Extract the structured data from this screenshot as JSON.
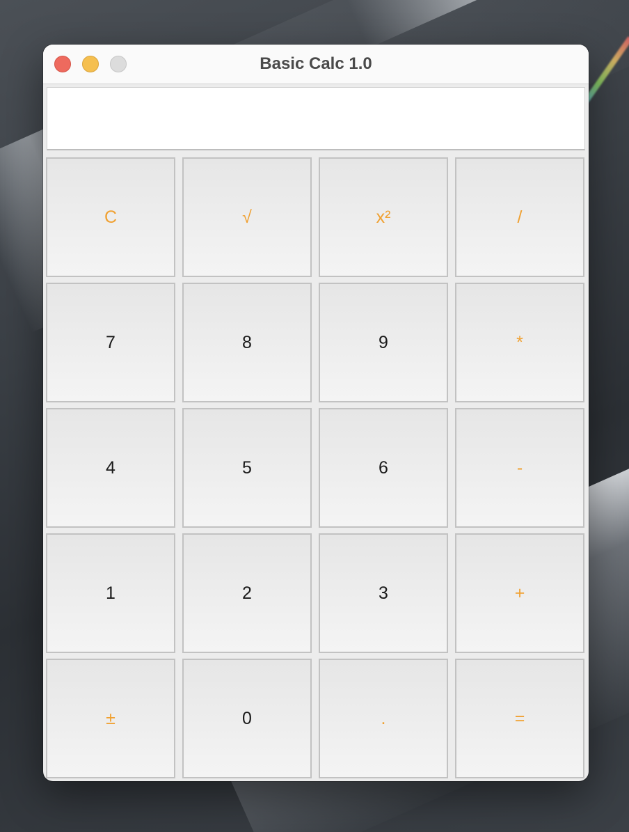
{
  "window": {
    "title": "Basic Calc 1.0"
  },
  "display": {
    "value": ""
  },
  "keys": [
    [
      {
        "label": "C",
        "kind": "op",
        "name": "clear-button"
      },
      {
        "label": "√",
        "kind": "op",
        "name": "sqrt-button"
      },
      {
        "label": "x²",
        "kind": "op",
        "name": "square-button"
      },
      {
        "label": "/",
        "kind": "op",
        "name": "divide-button"
      }
    ],
    [
      {
        "label": "7",
        "kind": "digit",
        "name": "digit-7-button"
      },
      {
        "label": "8",
        "kind": "digit",
        "name": "digit-8-button"
      },
      {
        "label": "9",
        "kind": "digit",
        "name": "digit-9-button"
      },
      {
        "label": "*",
        "kind": "op",
        "name": "multiply-button"
      }
    ],
    [
      {
        "label": "4",
        "kind": "digit",
        "name": "digit-4-button"
      },
      {
        "label": "5",
        "kind": "digit",
        "name": "digit-5-button"
      },
      {
        "label": "6",
        "kind": "digit",
        "name": "digit-6-button"
      },
      {
        "label": "-",
        "kind": "op",
        "name": "subtract-button"
      }
    ],
    [
      {
        "label": "1",
        "kind": "digit",
        "name": "digit-1-button"
      },
      {
        "label": "2",
        "kind": "digit",
        "name": "digit-2-button"
      },
      {
        "label": "3",
        "kind": "digit",
        "name": "digit-3-button"
      },
      {
        "label": "+",
        "kind": "op",
        "name": "add-button"
      }
    ],
    [
      {
        "label": "±",
        "kind": "op",
        "name": "negate-button"
      },
      {
        "label": "0",
        "kind": "digit",
        "name": "digit-0-button"
      },
      {
        "label": ".",
        "kind": "op",
        "name": "decimal-button"
      },
      {
        "label": "=",
        "kind": "op",
        "name": "equals-button"
      }
    ]
  ],
  "colors": {
    "operator_text": "#f0a030",
    "digit_text": "#1a1a1a",
    "traffic_close": "#ee6a5e",
    "traffic_minimize": "#f5bf4f",
    "traffic_zoom": "#dcdcdc"
  }
}
